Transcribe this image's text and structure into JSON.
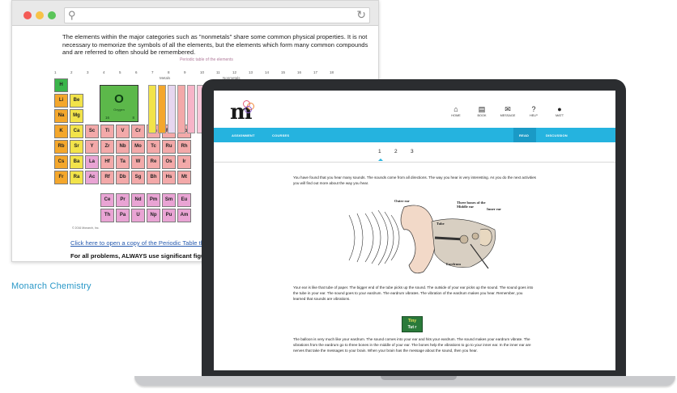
{
  "browser": {
    "intro": "The elements within the major categories such as \"nonmetals\" share some common physical properties. It is not necessary to memorize the symbols of all the elements, but the elements which form many common compounds and are referred to often should be remembered.",
    "table_subtitle": "Periodic table of the elements",
    "group_numbers": [
      "1",
      "2",
      "3",
      "4",
      "5",
      "6",
      "7",
      "8",
      "9",
      "10",
      "11",
      "12",
      "13",
      "14",
      "15",
      "16",
      "17",
      "18"
    ],
    "metals_label": "Metals",
    "nonmetals_label": "Nonmetals",
    "element": {
      "symbol": "O",
      "name": "Oxygen",
      "mass": "16",
      "number": "8"
    },
    "footnote": "© 2016 Monarch, Inc.",
    "link_text": "Click here to open a copy of the Periodic Table that can",
    "bold_text": "For all problems, ALWAYS use significant figure rul"
  },
  "caption": "Monarch Chemistry",
  "app": {
    "logo_text": "m",
    "nav": [
      {
        "icon": "home-icon",
        "glyph": "⌂",
        "label": "HOME"
      },
      {
        "icon": "book-icon",
        "glyph": "▤",
        "label": "BOOK"
      },
      {
        "icon": "message-icon",
        "glyph": "✉",
        "label": "MESSAGE"
      },
      {
        "icon": "help-icon",
        "glyph": "?",
        "label": "HELP"
      },
      {
        "icon": "user-icon",
        "glyph": "●",
        "label": "MATT"
      }
    ],
    "tabs": {
      "left_1": "ASSIGNMENT",
      "left_2": "COURSES",
      "right_1": "READ",
      "right_2": "DISCUSSION"
    },
    "pages": [
      "1",
      "2",
      "3"
    ],
    "para1": "You have found that you hear many sounds. The sounds come from all directions. The way you hear is very interesting. As you do the next activities you will find out more about the way you hear.",
    "para2": "Your ear is like that tube of paper. The bigger end of the tube picks up the sound. The outside of your ear picks up the sound. The sound goes into the tube in your ear. The sound goes to your eardrum. The eardrum vibrates. The vibration of the eardrum makes you hear. Remember, you learned that sounds are vibrations.",
    "para3": "The balloon is very much like your eardrum. The sound comes into your ear and hits your eardrum. The sound makes your eardrum vibrate. The vibrations from the eardrum go to three bones in the middle of your ear. The bones help the vibrations to go to your inner ear. In the inner ear are nerves that take the messages to your brain. When your brain has the message about the sound, then you hear.",
    "ear_labels": {
      "outer": "Outer ear",
      "bones": "Three bones of the Middle ear",
      "inner": "Inner ear",
      "tube": "Tube",
      "eardrum": "Eardrum"
    },
    "tutor": {
      "line1": "Tiny",
      "line2": "Tut r"
    }
  }
}
